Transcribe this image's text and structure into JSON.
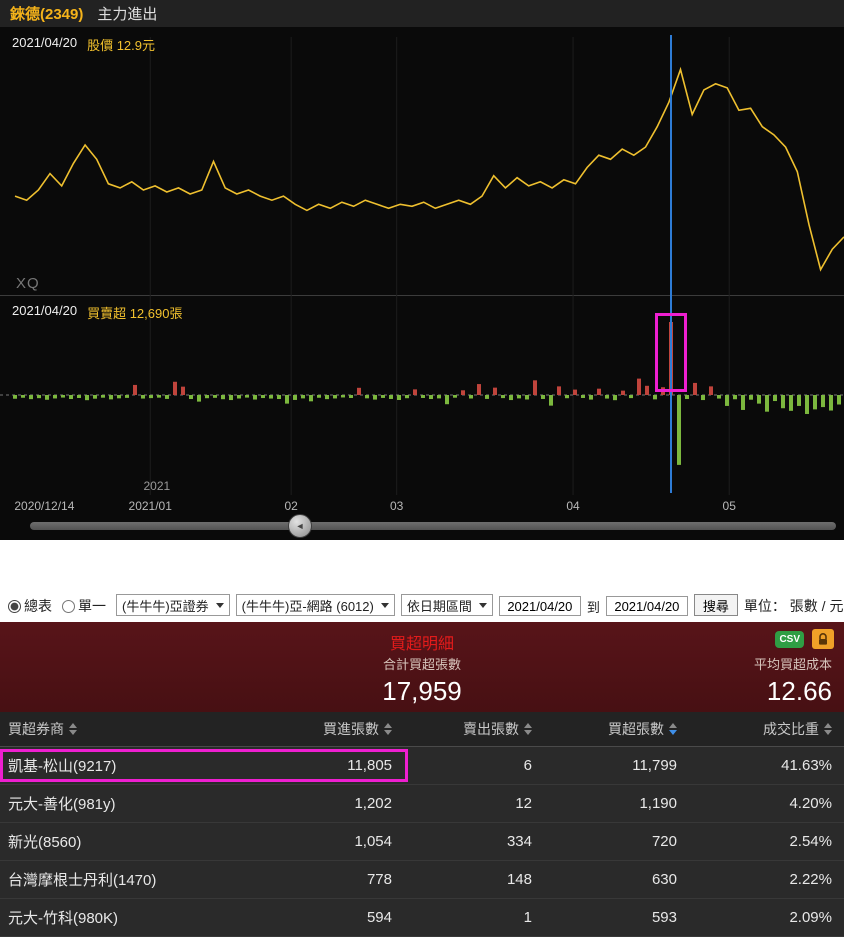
{
  "header": {
    "stock": "錸德(2349)",
    "page_title": "主力進出"
  },
  "price_chart": {
    "date_label": "2021/04/20",
    "price_label": "股價 12.9元",
    "watermark": "XQ"
  },
  "volume_chart": {
    "date_label": "2021/04/20",
    "value_label": "買賣超 12,690張"
  },
  "x_axis": {
    "year_label": "2021",
    "year_x": 0.17,
    "ticks": [
      {
        "label": "2020/12/14",
        "x": 0.017,
        "align": "left"
      },
      {
        "label": "2021/01",
        "x": 0.178
      },
      {
        "label": "02",
        "x": 0.345
      },
      {
        "label": "03",
        "x": 0.47
      },
      {
        "label": "04",
        "x": 0.679
      },
      {
        "label": "05",
        "x": 0.864
      }
    ]
  },
  "slider": {
    "position": 0.335
  },
  "chart_data": [
    {
      "type": "line",
      "name": "股價",
      "date": "2021/04/20",
      "value": 12.9,
      "unit": "元",
      "ylim": [
        10,
        16
      ],
      "values": [
        12.3,
        12.2,
        12.45,
        12.85,
        12.55,
        13.1,
        13.55,
        13.2,
        12.6,
        12.5,
        12.65,
        12.45,
        12.55,
        12.4,
        12.5,
        12.35,
        12.45,
        13.15,
        12.5,
        12.35,
        12.45,
        12.3,
        12.2,
        12.3,
        12.1,
        11.95,
        12.1,
        12.0,
        12.15,
        12.05,
        12.2,
        12.1,
        12.0,
        12.1,
        12.05,
        12.15,
        12.0,
        12.1,
        12.2,
        12.1,
        12.3,
        12.8,
        12.5,
        12.75,
        12.55,
        12.65,
        12.5,
        12.7,
        12.6,
        13.0,
        13.3,
        13.2,
        13.45,
        13.3,
        13.5,
        14.0,
        14.6,
        15.4,
        14.3,
        14.9,
        15.05,
        14.95,
        14.4,
        14.45,
        14.0,
        13.8,
        13.5,
        12.9,
        11.6,
        10.5,
        11.0,
        11.3
      ]
    },
    {
      "type": "bar",
      "name": "買賣超",
      "date": "2021/04/20",
      "value": 12690,
      "unit": "張",
      "max_abs": 12690,
      "highlight_index": 82,
      "values": [
        -650,
        -480,
        -720,
        -550,
        -830,
        -600,
        -450,
        -700,
        -520,
        -900,
        -640,
        -470,
        -760,
        -580,
        -500,
        1750,
        -620,
        -540,
        -460,
        -680,
        2300,
        1450,
        -700,
        -1150,
        -560,
        -490,
        -730,
        -880,
        -610,
        -450,
        -790,
        -530,
        -620,
        -700,
        -1500,
        -860,
        -590,
        -1100,
        -480,
        -720,
        -600,
        -430,
        -520,
        1250,
        -580,
        -800,
        -510,
        -690,
        -870,
        -560,
        980,
        -520,
        -700,
        -590,
        -1600,
        -470,
        820,
        -610,
        1900,
        -680,
        1280,
        -540,
        -880,
        -590,
        -780,
        2550,
        -690,
        -1850,
        1500,
        -560,
        940,
        -520,
        -800,
        1100,
        -620,
        -900,
        760,
        -540,
        2850,
        1600,
        -760,
        1350,
        12690,
        -12150,
        -700,
        2100,
        -880,
        1500,
        -620,
        -1900,
        -740,
        -2600,
        -820,
        -1500,
        -2900,
        -1050,
        -2300,
        -2750,
        -1900,
        -3300,
        -2500,
        -2100,
        -2700,
        -1650
      ]
    }
  ],
  "controls": {
    "radio_summary": "總表",
    "summary_selected": true,
    "radio_single": "單一",
    "broker_select": "(牛牛牛)亞證券",
    "branch_select": "(牛牛牛)亞-網路 (6012)",
    "range_select": "依日期區間",
    "date_from": "2021/04/20",
    "to_label": "到",
    "date_to": "2021/04/20",
    "search_button": "搜尋",
    "unit_label": "單位： 張數 / 元"
  },
  "table": {
    "title": "買超明細",
    "csv_label": "CSV",
    "total_label": "合計買超張數",
    "total_value": "17,959",
    "avg_label": "平均買超成本",
    "avg_value": "12.66",
    "columns": [
      {
        "label": "買超券商",
        "align": "left"
      },
      {
        "label": "買進張數",
        "align": "right"
      },
      {
        "label": "賣出張數",
        "align": "right"
      },
      {
        "label": "買超張數",
        "align": "right",
        "sorted": true
      },
      {
        "label": "成交比重",
        "align": "right"
      }
    ],
    "rows": [
      {
        "broker": "凱基-松山(9217)",
        "buy": "11,805",
        "sell": "6",
        "net": "11,799",
        "pct": "41.63%",
        "highlight": true
      },
      {
        "broker": "元大-善化(981y)",
        "buy": "1,202",
        "sell": "12",
        "net": "1,190",
        "pct": "4.20%"
      },
      {
        "broker": "新光(8560)",
        "buy": "1,054",
        "sell": "334",
        "net": "720",
        "pct": "2.54%"
      },
      {
        "broker": "台灣摩根士丹利(1470)",
        "buy": "778",
        "sell": "148",
        "net": "630",
        "pct": "2.22%"
      },
      {
        "broker": "元大-竹科(980K)",
        "buy": "594",
        "sell": "1",
        "net": "593",
        "pct": "2.09%"
      }
    ]
  },
  "colors": {
    "accent_yellow": "#f5b31a",
    "price_line": "#efc02f",
    "bar_up": "#c0443c",
    "bar_down": "#7cb83e",
    "highlight_magenta": "#ee1fd0",
    "marker_blue": "#2e7cd6",
    "band_red": "#581419",
    "title_red": "#e31b1b",
    "csv_green": "#2f9e44",
    "lock_orange": "#f0a128"
  }
}
